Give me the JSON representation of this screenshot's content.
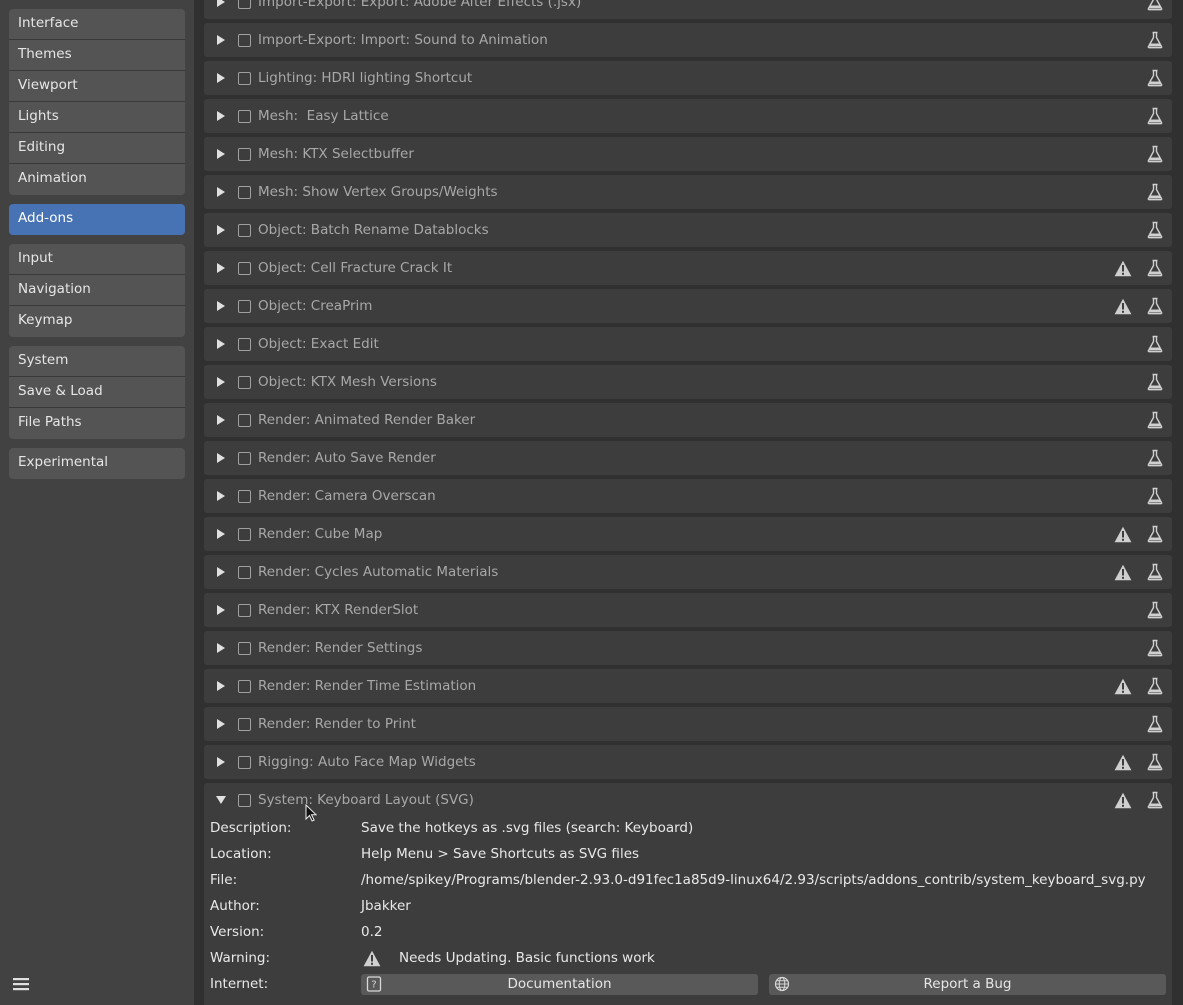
{
  "sidebar": {
    "groups": [
      [
        "Interface",
        "Themes",
        "Viewport",
        "Lights",
        "Editing",
        "Animation"
      ],
      [
        "Add-ons"
      ],
      [
        "Input",
        "Navigation",
        "Keymap"
      ],
      [
        "System",
        "Save & Load",
        "File Paths"
      ],
      [
        "Experimental"
      ]
    ],
    "active": "Add-ons"
  },
  "addons": [
    {
      "title": "Import-Export: Export: Adobe After Effects (.jsx)",
      "warning": false,
      "expanded": false
    },
    {
      "title": "Import-Export: Import: Sound to Animation",
      "warning": false,
      "expanded": false
    },
    {
      "title": "Lighting: HDRI lighting Shortcut",
      "warning": false,
      "expanded": false
    },
    {
      "title": "Mesh:  Easy Lattice",
      "warning": false,
      "expanded": false
    },
    {
      "title": "Mesh: KTX Selectbuffer",
      "warning": false,
      "expanded": false
    },
    {
      "title": "Mesh: Show Vertex Groups/Weights",
      "warning": false,
      "expanded": false
    },
    {
      "title": "Object: Batch Rename Datablocks",
      "warning": false,
      "expanded": false
    },
    {
      "title": "Object: Cell Fracture Crack It",
      "warning": true,
      "expanded": false
    },
    {
      "title": "Object: CreaPrim",
      "warning": true,
      "expanded": false
    },
    {
      "title": "Object: Exact Edit",
      "warning": false,
      "expanded": false
    },
    {
      "title": "Object: KTX Mesh Versions",
      "warning": false,
      "expanded": false
    },
    {
      "title": "Render: Animated Render Baker",
      "warning": false,
      "expanded": false
    },
    {
      "title": "Render: Auto Save Render",
      "warning": false,
      "expanded": false
    },
    {
      "title": "Render: Camera Overscan",
      "warning": false,
      "expanded": false
    },
    {
      "title": "Render: Cube Map",
      "warning": true,
      "expanded": false
    },
    {
      "title": "Render: Cycles Automatic Materials",
      "warning": true,
      "expanded": false
    },
    {
      "title": "Render: KTX RenderSlot",
      "warning": false,
      "expanded": false
    },
    {
      "title": "Render: Render Settings",
      "warning": false,
      "expanded": false
    },
    {
      "title": "Render: Render Time Estimation",
      "warning": true,
      "expanded": false
    },
    {
      "title": "Render: Render to Print",
      "warning": false,
      "expanded": false
    },
    {
      "title": "Rigging: Auto Face Map Widgets",
      "warning": true,
      "expanded": false
    },
    {
      "title": "System: Keyboard Layout (SVG)",
      "warning": true,
      "expanded": true
    }
  ],
  "details": {
    "description_label": "Description:",
    "description": "Save the hotkeys as .svg files (search: Keyboard)",
    "location_label": "Location:",
    "location": "Help Menu > Save Shortcuts as SVG files",
    "file_label": "File:",
    "file": "/home/spikey/Programs/blender-2.93.0-d91fec1a85d9-linux64/2.93/scripts/addons_contrib/system_keyboard_svg.py",
    "author_label": "Author:",
    "author": "Jbakker",
    "version_label": "Version:",
    "version": "0.2",
    "warning_label": "Warning:",
    "warning": "Needs Updating. Basic functions work",
    "internet_label": "Internet:",
    "documentation_button": "Documentation",
    "report_bug_button": "Report a Bug"
  },
  "colors": {
    "active_nav": "#4772b3",
    "row_bg": "#3d3d3d",
    "sidebar_bg": "#424242"
  }
}
